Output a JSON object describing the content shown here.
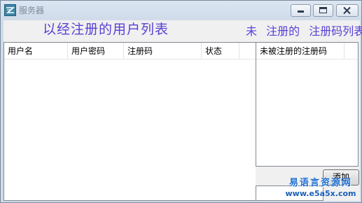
{
  "window": {
    "title": "服务器"
  },
  "headings": {
    "left": "以经注册的用户列表",
    "right_part1": "未",
    "right_part2": "注册的",
    "right_part3": "注册码列表"
  },
  "users_list": {
    "columns": [
      "用户名",
      "用户密码",
      "注册码",
      "状态",
      ""
    ],
    "rows": []
  },
  "codes_list": {
    "columns": [
      "未被注册的注册码",
      ""
    ],
    "rows": []
  },
  "code_input": {
    "value": ""
  },
  "add_button": {
    "label": "添加"
  },
  "watermark": {
    "line1": "易语言资源网",
    "line2": "www.e5a5x.com"
  }
}
